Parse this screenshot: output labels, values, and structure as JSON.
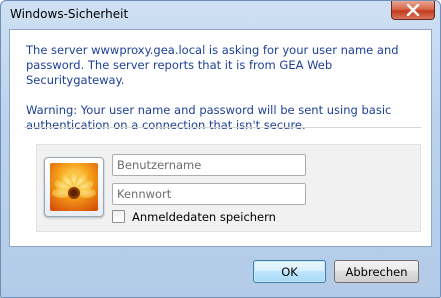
{
  "window": {
    "title": "Windows-Sicherheit"
  },
  "message": {
    "line1": "The server wwwproxy.gea.local is asking for your user name and password. The server reports that it is from GEA Web Securitygateway.",
    "warning": "Warning: Your user name and password will be sent using basic authentication on a connection that isn't secure."
  },
  "credentials": {
    "username_placeholder": "Benutzername",
    "username_value": "",
    "password_placeholder": "Kennwort",
    "password_value": "",
    "remember_label": "Anmeldedaten speichern",
    "remember_checked": false
  },
  "buttons": {
    "ok_label": "OK",
    "cancel_label": "Abbrechen"
  },
  "icons": {
    "close": "close-icon",
    "avatar": "user-avatar-flower-icon"
  }
}
